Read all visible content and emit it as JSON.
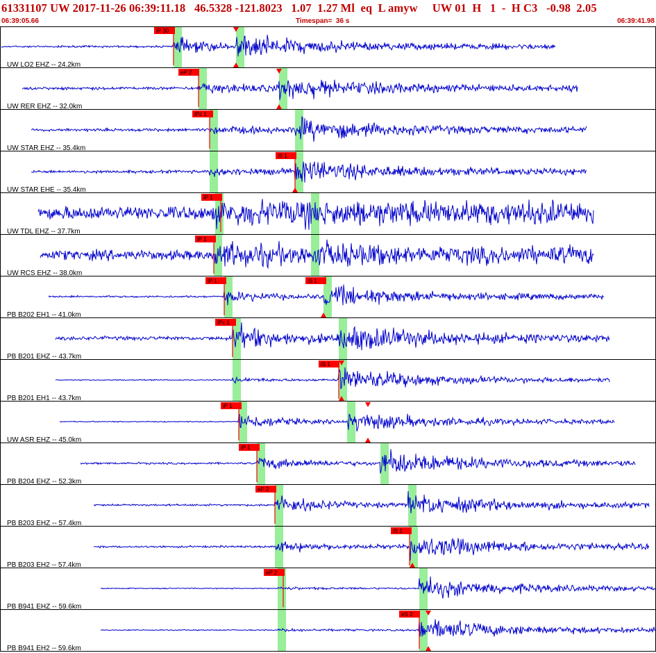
{
  "header": {
    "title": "61331107 UW 2017-11-26 06:39:11.18   46.5328 -121.8023   1.07  1.27 Ml  eq  L amyw     UW 01  H   1  -  H C3   -0.98  2.05",
    "start_time": "06:39:05.66",
    "timespan": "Timespan=  36 s",
    "end_time": "06:39:41.98"
  },
  "colors": {
    "header_text": "#c00000",
    "waveform": "#0000cc",
    "pick_flag": "#ff0000",
    "pick_window": "#99ee99",
    "panel_border": "#000000"
  },
  "traces": [
    {
      "label": "UW LO2 EHZ -- 24.2km",
      "picks": [
        {
          "text": "iP 30"
        }
      ]
    },
    {
      "label": "UW RER EHZ -- 32.0km",
      "picks": [
        {
          "text": "eP 2"
        }
      ]
    },
    {
      "label": "UW STAR EHZ -- 35.4km",
      "picks": [
        {
          "text": "iPc 1"
        }
      ]
    },
    {
      "label": "UW STAR EHE -- 35.4km",
      "picks": [
        {
          "text": "iS 1"
        }
      ]
    },
    {
      "label": "UW TDL EHZ -- 37.7km",
      "picks": [
        {
          "text": "iP 1"
        }
      ]
    },
    {
      "label": "UW RCS EHZ -- 38.0km",
      "picks": [
        {
          "text": "iP 1"
        }
      ]
    },
    {
      "label": "PB B202 EH1 -- 41.0km",
      "picks": [
        {
          "text": "iP 1"
        },
        {
          "text": "iS 1"
        }
      ]
    },
    {
      "label": "PB B201 EHZ -- 43.7km",
      "picks": [
        {
          "text": "iPc 1"
        }
      ]
    },
    {
      "label": "PB B201 EH1 -- 43.7km",
      "picks": [
        {
          "text": "iS 1"
        }
      ]
    },
    {
      "label": "UW ASR EHZ -- 45.0km",
      "picks": [
        {
          "text": "iP 1"
        }
      ]
    },
    {
      "label": "PB B204 EHZ -- 52.3km",
      "picks": [
        {
          "text": "iP 1"
        }
      ]
    },
    {
      "label": "PB B203 EHZ -- 57.4km",
      "picks": [
        {
          "text": "eP 2"
        }
      ]
    },
    {
      "label": "PB B203 EH2 -- 57.4km",
      "picks": [
        {
          "text": "iS 1"
        }
      ]
    },
    {
      "label": "PB B941 EHZ -- 59.6km",
      "picks": [
        {
          "text": "eP 2"
        }
      ]
    },
    {
      "label": "PB B941 EH2 -- 59.6km",
      "picks": [
        {
          "text": "eS 2"
        }
      ]
    }
  ]
}
